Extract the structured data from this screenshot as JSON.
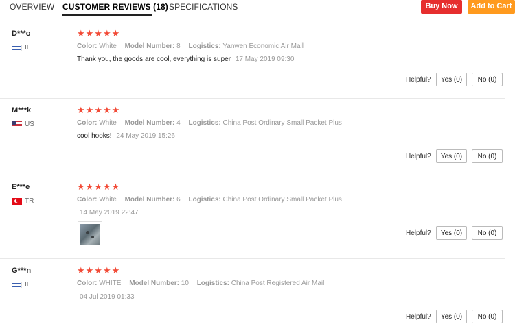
{
  "tabs": {
    "overview": "OVERVIEW",
    "reviews": "CUSTOMER REVIEWS (18)",
    "specs": "SPECIFICATIONS"
  },
  "actions": {
    "buy_now": "Buy Now",
    "add_to_cart": "Add to Cart"
  },
  "colors": {
    "buy_now": "#e62e2e",
    "add_to_cart": "#ff9a1e",
    "stars": "#f24a36"
  },
  "reviews": [
    {
      "name": "D***o",
      "country": "IL",
      "flag_icon": "israel-flag-icon",
      "stars": "★★★★★",
      "rating": 5,
      "color_label": "Color:",
      "color": "White",
      "model_label": "Model Number:",
      "model": "8",
      "logistics_label": "Logistics:",
      "logistics": "Yanwen Economic Air Mail",
      "text": "Thank you, the goods are cool, everything is super",
      "date": "17 May 2019 09:30",
      "helpful": "Helpful?",
      "yes": "Yes (0)",
      "no": "No (0)"
    },
    {
      "name": "M***k",
      "country": "US",
      "flag_icon": "us-flag-icon",
      "stars": "★★★★★",
      "rating": 5,
      "color_label": "Color:",
      "color": "White",
      "model_label": "Model Number:",
      "model": "4",
      "logistics_label": "Logistics:",
      "logistics": "China Post Ordinary Small Packet Plus",
      "text": "cool hooks!",
      "date": "24 May 2019 15:26",
      "helpful": "Helpful?",
      "yes": "Yes (0)",
      "no": "No (0)"
    },
    {
      "name": "E***e",
      "country": "TR",
      "flag_icon": "turkey-flag-icon",
      "stars": "★★★★★",
      "rating": 5,
      "color_label": "Color:",
      "color": "White",
      "model_label": "Model Number:",
      "model": "6",
      "logistics_label": "Logistics:",
      "logistics": "China Post Ordinary Small Packet Plus",
      "text": "",
      "date": "14 May 2019 22:47",
      "helpful": "Helpful?",
      "yes": "Yes (0)",
      "no": "No (0)"
    },
    {
      "name": "G***n",
      "country": "IL",
      "flag_icon": "israel-flag-icon",
      "stars": "★★★★★",
      "rating": 5,
      "color_label": "Color:",
      "color": "WHITE",
      "model_label": "Model Number:",
      "model": "10",
      "logistics_label": "Logistics:",
      "logistics": "China Post Registered Air Mail",
      "text": "",
      "date": "04 Jul 2019 01:33",
      "helpful": "Helpful?",
      "yes": "Yes (0)",
      "no": "No (0)"
    }
  ]
}
